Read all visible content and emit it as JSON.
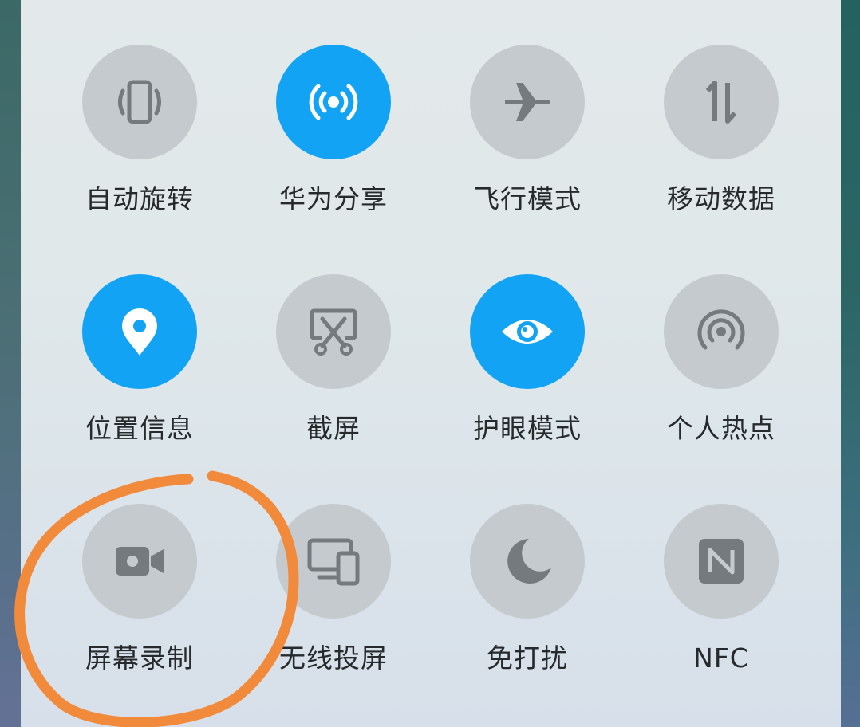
{
  "tiles": [
    {
      "id": "auto-rotate",
      "label": "自动旋转",
      "icon": "auto-rotate-icon",
      "active": false
    },
    {
      "id": "huawei-share",
      "label": "华为分享",
      "icon": "huawei-share-icon",
      "active": true
    },
    {
      "id": "airplane-mode",
      "label": "飞行模式",
      "icon": "airplane-icon",
      "active": false
    },
    {
      "id": "mobile-data",
      "label": "移动数据",
      "icon": "mobile-data-icon",
      "active": false
    },
    {
      "id": "location",
      "label": "位置信息",
      "icon": "location-pin-icon",
      "active": true
    },
    {
      "id": "screenshot",
      "label": "截屏",
      "icon": "screenshot-icon",
      "active": false
    },
    {
      "id": "eye-comfort",
      "label": "护眼模式",
      "icon": "eye-icon",
      "active": true
    },
    {
      "id": "hotspot",
      "label": "个人热点",
      "icon": "hotspot-icon",
      "active": false
    },
    {
      "id": "screen-record",
      "label": "屏幕录制",
      "icon": "video-camera-icon",
      "active": false
    },
    {
      "id": "wireless-proj",
      "label": "无线投屏",
      "icon": "projection-icon",
      "active": false
    },
    {
      "id": "do-not-disturb",
      "label": "免打扰",
      "icon": "moon-icon",
      "active": false
    },
    {
      "id": "nfc",
      "label": "NFC",
      "icon": "nfc-icon",
      "active": false
    }
  ],
  "colors": {
    "active": "#13a3f5",
    "inactive": "#c4cacd",
    "icon_inactive": "#747a7d",
    "icon_active": "#ffffff",
    "label": "#262a2d",
    "annotation": "#f28a3c"
  }
}
